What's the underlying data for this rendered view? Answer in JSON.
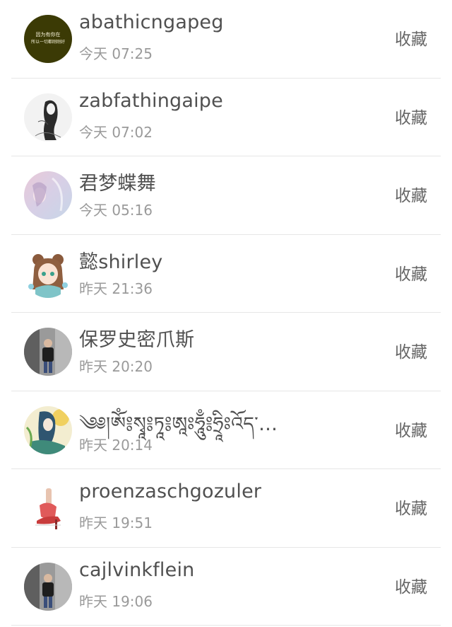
{
  "collect_label": "收藏",
  "items": [
    {
      "name": "abathicngapeg",
      "time": "今天 07:25",
      "avatar": "text-avatar-icon",
      "avatar_text": [
        "因为有你在",
        "所以一切都刚刚好"
      ]
    },
    {
      "name": "zabfathingaipe",
      "time": "今天 07:02",
      "avatar": "sketch-girl-avatar-icon"
    },
    {
      "name": "君梦蝶舞",
      "time": "今天 05:16",
      "avatar": "pastel-painting-avatar-icon"
    },
    {
      "name": "懿shirley",
      "time": "昨天 21:36",
      "avatar": "anime-girl-avatar-icon"
    },
    {
      "name": "保罗史密爪斯",
      "time": "昨天 20:20",
      "avatar": "person-photo-avatar-icon"
    },
    {
      "name": "༄༅།ཨོཾ༔སྭཱ༔ཏཱ༔ཨཱཿཧཱུྃ༔ཧྲཱིཿའོད་…",
      "time": "昨天 20:14",
      "avatar": "anime-boy-avatar-icon"
    },
    {
      "name": "proenzaschgozuler",
      "time": "昨天 19:51",
      "avatar": "high-heel-avatar-icon"
    },
    {
      "name": "cajlvinkflein",
      "time": "昨天 19:06",
      "avatar": "person-photo-avatar-icon"
    }
  ]
}
